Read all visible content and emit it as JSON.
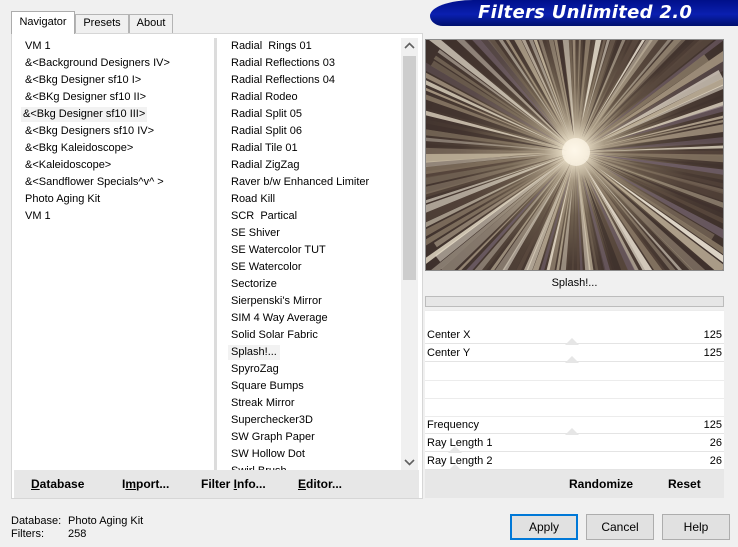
{
  "app": {
    "title": "Filters Unlimited 2.0"
  },
  "tabs": [
    "Navigator",
    "Presets",
    "About"
  ],
  "categories": [
    " VM 1",
    "&<Background Designers IV>",
    "&<Bkg Designer sf10 I>",
    "&<BKg Designer sf10 II>",
    "&<Bkg Designer sf10 III>",
    "&<Bkg Designers sf10 IV>",
    "&<Bkg Kaleidoscope>",
    "&<Kaleidoscope>",
    "&<Sandflower Specials^v^ >",
    "Photo Aging Kit",
    "VM 1"
  ],
  "selected_category_index": 4,
  "filters": [
    "Radial  Rings 01",
    "Radial Reflections 03",
    "Radial Reflections 04",
    "Radial Rodeo",
    "Radial Split 05",
    "Radial Split 06",
    "Radial Tile 01",
    "Radial ZigZag",
    "Raver b/w Enhanced Limiter",
    "Road Kill",
    "SCR  Partical",
    "SE Shiver",
    "SE Watercolor TUT",
    "SE Watercolor",
    "Sectorize",
    "Sierpenski's Mirror",
    "SIM 4 Way Average",
    "Solid Solar Fabric",
    "Splash!...",
    "SpyroZag",
    "Square Bumps",
    "Streak Mirror",
    "Superchecker3D",
    "SW Graph Paper",
    "SW Hollow Dot",
    "Swirl Brush"
  ],
  "selected_filter_index": 18,
  "scrollbar": {
    "up_icon": "chevron-up-icon",
    "down_icon": "chevron-down-icon"
  },
  "toolbar": {
    "database": {
      "u": "D",
      "rest": "atabase"
    },
    "import": {
      "pre": "I",
      "u": "m",
      "rest": "port..."
    },
    "filter_info": {
      "pre": "Filter ",
      "u": "I",
      "rest": "nfo..."
    },
    "editor": {
      "u": "E",
      "rest": "ditor..."
    }
  },
  "preview": {
    "filter_name": "Splash!...",
    "progress": 0
  },
  "parameters": [
    {
      "name": "Center X",
      "value": "125",
      "level": 0.49
    },
    {
      "name": "Center Y",
      "value": "125",
      "level": 0.49
    },
    {
      "name": "Frequency",
      "value": "125",
      "level": 0.49
    },
    {
      "name": "Ray Length 1",
      "value": "26",
      "level": 0.1
    },
    {
      "name": "Ray Length 2",
      "value": "26",
      "level": 0.1
    }
  ],
  "toolbar2": {
    "randomize": "Randomize",
    "reset": "Reset"
  },
  "status": {
    "database_label": "Database:",
    "database_value": "Photo Aging Kit",
    "filters_label": "Filters:",
    "filters_value": "258"
  },
  "buttons": {
    "apply": "Apply",
    "cancel": "Cancel",
    "help": "Help"
  }
}
